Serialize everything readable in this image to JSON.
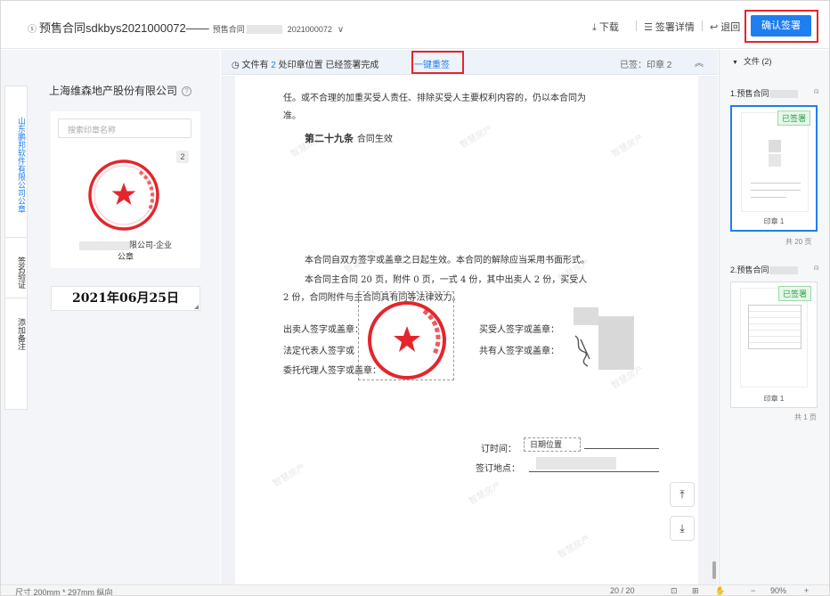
{
  "header": {
    "doc_title_prefix": "预售合同sdkbys2021000072——",
    "doc_title_sub": "预售合同",
    "doc_title_sub_tail": "2021000072",
    "download_label": "下载",
    "sign_details_label": "签署详情",
    "return_label": "退回",
    "confirm_label": "确认签署"
  },
  "left_tabs": [
    {
      "label": "山东鹏邦软件有限公司公章"
    },
    {
      "label": "签名验证"
    },
    {
      "label": "添加备注"
    }
  ],
  "left_panel": {
    "company": "上海维森地产股份有限公司",
    "help_icon": "?",
    "search_placeholder": "搜索印章名称",
    "seal_count": "2",
    "seal_name_tail": "限公司-企业",
    "seal_name_line2": "公章",
    "date_stamp": "2021年06月25日"
  },
  "notice": {
    "text_prefix": "文件有",
    "count": "2",
    "text_suffix": "处印章位置 已经签署完成",
    "link": "一键重签",
    "signed_status": "已签：印章 2"
  },
  "document": {
    "line1": "任。或不合理的加重买受人责任、排除买受人主要权利内容的，仍以本合同为",
    "line2": "准。",
    "article": "第二十九条",
    "article_title": "合同生效",
    "para1": "本合同自双方签字或盖章之日起生效。本合同的解除应当采用书面形式。",
    "para2": "本合同主合同 20 页，附件 0 页，一式 4 份，其中出卖人 2 份，买受人",
    "para3": "2 份，合同附件与主合同具有同等法律效力。",
    "seller_sign": "出卖人签字或盖章：",
    "seller_rep": "法定代表人签字或",
    "seller_agent": "委托代理人签字或盖章：",
    "buyer_sign": "买受人签字或盖章：",
    "buyer_common": "共有人签字或盖章：",
    "sign_time_label": "订时间：",
    "sign_time_value": "日期位置",
    "sign_place_label": "签订地点：",
    "watermark": "智慧房产"
  },
  "right_panel": {
    "file_header": "文件 (2)",
    "files": [
      {
        "name": "1.预售合同",
        "badge": "已签署",
        "caption": "印章 1",
        "pages": "共 20 页"
      },
      {
        "name": "2.预售合同",
        "badge": "已签署",
        "caption": "印章 1",
        "pages": "共 1 页"
      }
    ]
  },
  "footer": {
    "page_size": "尺寸 200mm * 297mm 纵向",
    "page_indicator": "20 / 20",
    "zoom_minus": "−",
    "zoom": "90%",
    "zoom_plus": "+"
  },
  "colors": {
    "accent": "#1f7ef0",
    "seal_red": "#e3262c",
    "signed_green": "#2aa34a"
  }
}
